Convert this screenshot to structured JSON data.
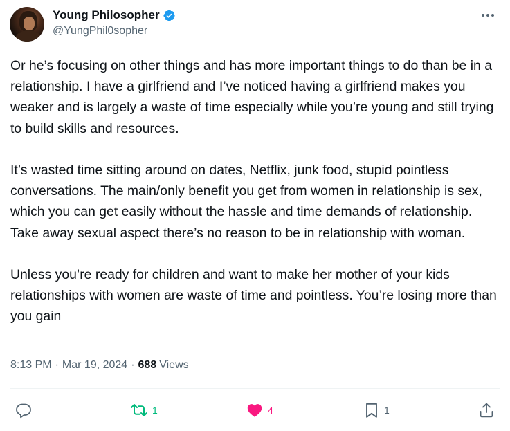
{
  "author": {
    "display_name": "Young Philosopher",
    "handle": "@YungPhil0sopher",
    "verified": true,
    "verified_color": "#1d9bf0"
  },
  "tweet": {
    "paragraphs": [
      "Or he’s focusing on other things and has more important things to do than be in a relationship. I have a girlfriend and I’ve noticed having a girlfriend makes you weaker and is largely a waste of time especially while you’re young and still trying to build skills and resources.",
      "It’s wasted time sitting around on dates, Netflix, junk food, stupid pointless conversations. The main/only benefit you get from women in relationship is sex, which you can get easily without the hassle and time demands of relationship. Take away sexual aspect there’s no reason to be in relationship with woman.",
      "Unless you’re ready for children and want to make her mother of your kids relationships with women are waste of time and pointless. You’re losing more than you gain"
    ]
  },
  "meta": {
    "time": "8:13 PM",
    "separator": "·",
    "date": "Mar 19, 2024",
    "views_count": "688",
    "views_label": "Views"
  },
  "actions": {
    "reply": {
      "icon": "reply-icon",
      "count": ""
    },
    "retweet": {
      "icon": "retweet-icon",
      "count": "1",
      "color": "#00ba7c"
    },
    "like": {
      "icon": "heart-icon",
      "count": "4",
      "color": "#f91880"
    },
    "bookmark": {
      "icon": "bookmark-icon",
      "count": "1"
    },
    "share": {
      "icon": "share-icon"
    }
  }
}
